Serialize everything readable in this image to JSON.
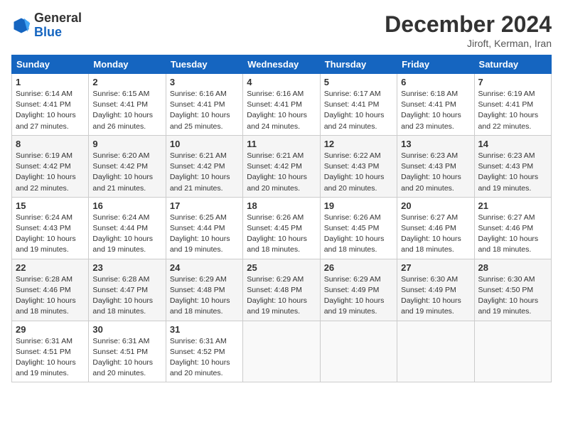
{
  "header": {
    "logo_line1": "General",
    "logo_line2": "Blue",
    "month": "December 2024",
    "location": "Jiroft, Kerman, Iran"
  },
  "weekdays": [
    "Sunday",
    "Monday",
    "Tuesday",
    "Wednesday",
    "Thursday",
    "Friday",
    "Saturday"
  ],
  "weeks": [
    [
      {
        "day": 1,
        "sunrise": "6:14 AM",
        "sunset": "4:41 PM",
        "daylight": "10 hours and 27 minutes."
      },
      {
        "day": 2,
        "sunrise": "6:15 AM",
        "sunset": "4:41 PM",
        "daylight": "10 hours and 26 minutes."
      },
      {
        "day": 3,
        "sunrise": "6:16 AM",
        "sunset": "4:41 PM",
        "daylight": "10 hours and 25 minutes."
      },
      {
        "day": 4,
        "sunrise": "6:16 AM",
        "sunset": "4:41 PM",
        "daylight": "10 hours and 24 minutes."
      },
      {
        "day": 5,
        "sunrise": "6:17 AM",
        "sunset": "4:41 PM",
        "daylight": "10 hours and 24 minutes."
      },
      {
        "day": 6,
        "sunrise": "6:18 AM",
        "sunset": "4:41 PM",
        "daylight": "10 hours and 23 minutes."
      },
      {
        "day": 7,
        "sunrise": "6:19 AM",
        "sunset": "4:41 PM",
        "daylight": "10 hours and 22 minutes."
      }
    ],
    [
      {
        "day": 8,
        "sunrise": "6:19 AM",
        "sunset": "4:42 PM",
        "daylight": "10 hours and 22 minutes."
      },
      {
        "day": 9,
        "sunrise": "6:20 AM",
        "sunset": "4:42 PM",
        "daylight": "10 hours and 21 minutes."
      },
      {
        "day": 10,
        "sunrise": "6:21 AM",
        "sunset": "4:42 PM",
        "daylight": "10 hours and 21 minutes."
      },
      {
        "day": 11,
        "sunrise": "6:21 AM",
        "sunset": "4:42 PM",
        "daylight": "10 hours and 20 minutes."
      },
      {
        "day": 12,
        "sunrise": "6:22 AM",
        "sunset": "4:43 PM",
        "daylight": "10 hours and 20 minutes."
      },
      {
        "day": 13,
        "sunrise": "6:23 AM",
        "sunset": "4:43 PM",
        "daylight": "10 hours and 20 minutes."
      },
      {
        "day": 14,
        "sunrise": "6:23 AM",
        "sunset": "4:43 PM",
        "daylight": "10 hours and 19 minutes."
      }
    ],
    [
      {
        "day": 15,
        "sunrise": "6:24 AM",
        "sunset": "4:43 PM",
        "daylight": "10 hours and 19 minutes."
      },
      {
        "day": 16,
        "sunrise": "6:24 AM",
        "sunset": "4:44 PM",
        "daylight": "10 hours and 19 minutes."
      },
      {
        "day": 17,
        "sunrise": "6:25 AM",
        "sunset": "4:44 PM",
        "daylight": "10 hours and 19 minutes."
      },
      {
        "day": 18,
        "sunrise": "6:26 AM",
        "sunset": "4:45 PM",
        "daylight": "10 hours and 18 minutes."
      },
      {
        "day": 19,
        "sunrise": "6:26 AM",
        "sunset": "4:45 PM",
        "daylight": "10 hours and 18 minutes."
      },
      {
        "day": 20,
        "sunrise": "6:27 AM",
        "sunset": "4:46 PM",
        "daylight": "10 hours and 18 minutes."
      },
      {
        "day": 21,
        "sunrise": "6:27 AM",
        "sunset": "4:46 PM",
        "daylight": "10 hours and 18 minutes."
      }
    ],
    [
      {
        "day": 22,
        "sunrise": "6:28 AM",
        "sunset": "4:46 PM",
        "daylight": "10 hours and 18 minutes."
      },
      {
        "day": 23,
        "sunrise": "6:28 AM",
        "sunset": "4:47 PM",
        "daylight": "10 hours and 18 minutes."
      },
      {
        "day": 24,
        "sunrise": "6:29 AM",
        "sunset": "4:48 PM",
        "daylight": "10 hours and 18 minutes."
      },
      {
        "day": 25,
        "sunrise": "6:29 AM",
        "sunset": "4:48 PM",
        "daylight": "10 hours and 19 minutes."
      },
      {
        "day": 26,
        "sunrise": "6:29 AM",
        "sunset": "4:49 PM",
        "daylight": "10 hours and 19 minutes."
      },
      {
        "day": 27,
        "sunrise": "6:30 AM",
        "sunset": "4:49 PM",
        "daylight": "10 hours and 19 minutes."
      },
      {
        "day": 28,
        "sunrise": "6:30 AM",
        "sunset": "4:50 PM",
        "daylight": "10 hours and 19 minutes."
      }
    ],
    [
      {
        "day": 29,
        "sunrise": "6:31 AM",
        "sunset": "4:51 PM",
        "daylight": "10 hours and 19 minutes."
      },
      {
        "day": 30,
        "sunrise": "6:31 AM",
        "sunset": "4:51 PM",
        "daylight": "10 hours and 20 minutes."
      },
      {
        "day": 31,
        "sunrise": "6:31 AM",
        "sunset": "4:52 PM",
        "daylight": "10 hours and 20 minutes."
      },
      null,
      null,
      null,
      null
    ]
  ]
}
